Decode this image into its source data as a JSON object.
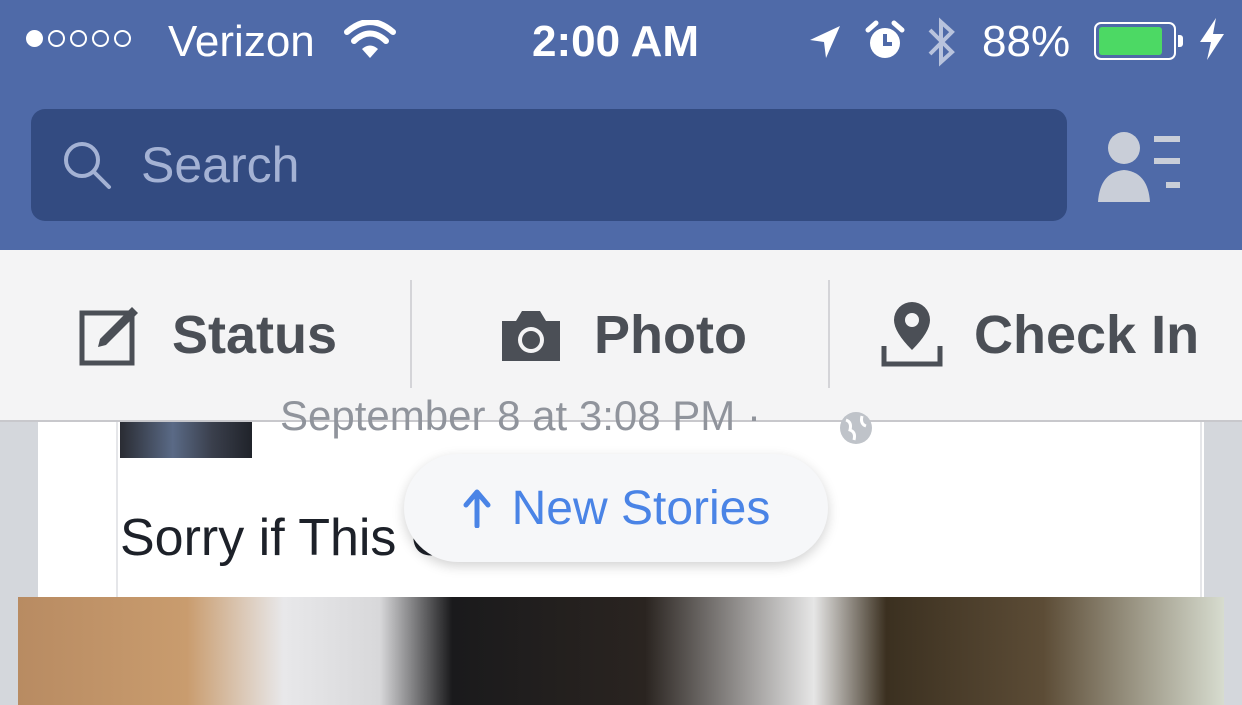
{
  "status_bar": {
    "signal_dots": 5,
    "signal_filled": 1,
    "carrier": "Verizon",
    "time": "2:00 AM",
    "battery_percent_text": "88%",
    "battery_level": 0.88,
    "icons": [
      "wifi-icon",
      "location-arrow-icon",
      "alarm-icon",
      "bluetooth-icon",
      "battery-icon",
      "charging-bolt-icon"
    ]
  },
  "search": {
    "placeholder": "Search"
  },
  "composer": {
    "status_label": "Status",
    "photo_label": "Photo",
    "checkin_label": "Check In"
  },
  "post": {
    "timestamp": "September 8 at 3:08 PM",
    "separator": "·",
    "text": "Sorry if This Offends You."
  },
  "new_stories": {
    "label": "New Stories"
  },
  "colors": {
    "brand": "#4f6aa8",
    "search_bg": "#334b81",
    "battery_fill": "#4cd964",
    "new_stories_text": "#4a84e6"
  }
}
